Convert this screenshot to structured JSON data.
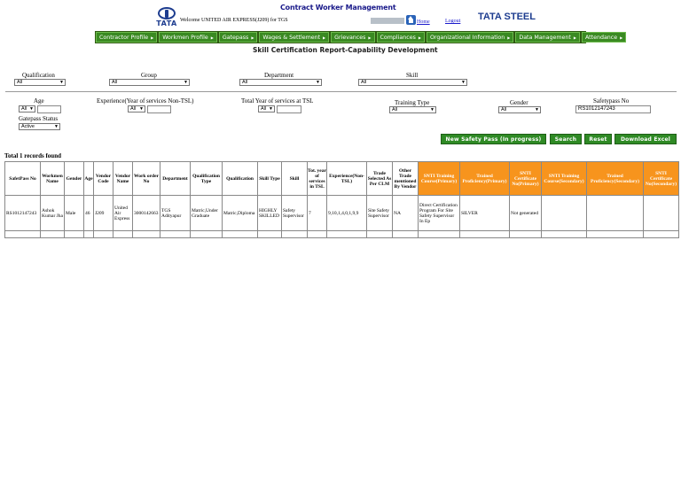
{
  "header": {
    "app_title": "Contract Worker Management",
    "logo_word": "TATA",
    "welcome_text": "Welcome UNITED AIR EXPRESS(J209) for TGS",
    "home_label": "Home",
    "logout_label": "Logout",
    "brand_right": "TATA STEEL"
  },
  "nav": {
    "items": [
      "Contractor Profile",
      "Workmen Profile",
      "Gatepass",
      "Wages & Settlement",
      "Grievances",
      "Compliances",
      "Organizational Information",
      "Data Management",
      "Attendance"
    ]
  },
  "page_title": "Skill Certification Report-Capability Development",
  "filters": {
    "qualification": {
      "label": "Qualification",
      "value": "All"
    },
    "group": {
      "label": "Group",
      "value": "All"
    },
    "department": {
      "label": "Department",
      "value": "All"
    },
    "skill": {
      "label": "Skill",
      "value": "All"
    },
    "age": {
      "label": "Age",
      "value": "All",
      "text": ""
    },
    "experience": {
      "label": "Experience(Year of services Non-TSL)",
      "value": "All",
      "text": ""
    },
    "total_year": {
      "label": "Total Year of services at TSL",
      "value": "All",
      "text": ""
    },
    "training_type": {
      "label": "Training Type",
      "value": "All"
    },
    "gender": {
      "label": "Gender",
      "value": "All"
    },
    "safetypass": {
      "label": "Safetypass No",
      "value": "RS1012147243"
    },
    "gatepass_status": {
      "label": "Gatepass Status",
      "value": "Active"
    }
  },
  "buttons": {
    "new_safety_pass": "New Safety Pass (In progress)",
    "search": "Search",
    "reset": "Reset",
    "download_excel": "Download Excel"
  },
  "records_text": "Total 1 records found",
  "table": {
    "headers": [
      "SafetPass No",
      "Workmen Name",
      "Gender",
      "Age",
      "Vendor Code",
      "Vendor Name",
      "Work order No",
      "Department",
      "Qualification Type",
      "Qualification",
      "Skill Type",
      "Skill",
      "Tot. year of services in TSL",
      "Experience(Non-TSL)",
      "Trade Selected As Per CLM",
      "Other Trade mentioned By Vendor",
      "SNTI Training Course(Primary)",
      "Trained Proficiency(Primary)",
      "SNTI Certificate No(Primary)",
      "SNTI Training Course(Secondary)",
      "Trained Proficiency(Secondary)",
      "SNTI Certificate No(Secondary)"
    ],
    "rows": [
      [
        "RS1012147243",
        "Ashok Kumar Jha",
        "Male",
        "46",
        "J209",
        "United Air Express",
        "3000142663",
        "TGS Adityapur",
        "Matric,Under Graduate",
        "Matric,Diploma",
        "HIGHLY SKILLED",
        "Safety Supervisor",
        "7",
        "9,10,1,4,0,1,9,9",
        "Site Safety Supervisor",
        "NA",
        "Direct Certification Program For Site Safety Supervisor In Ep",
        "SILVER",
        "Not generated",
        "",
        "",
        ""
      ]
    ]
  },
  "colors": {
    "nav_bg": "#2e5a12",
    "nav_item": "#3a8a22",
    "button_green": "#2f8a25",
    "header_orange": "#f7941d",
    "brand_blue": "#1d3c8f"
  }
}
